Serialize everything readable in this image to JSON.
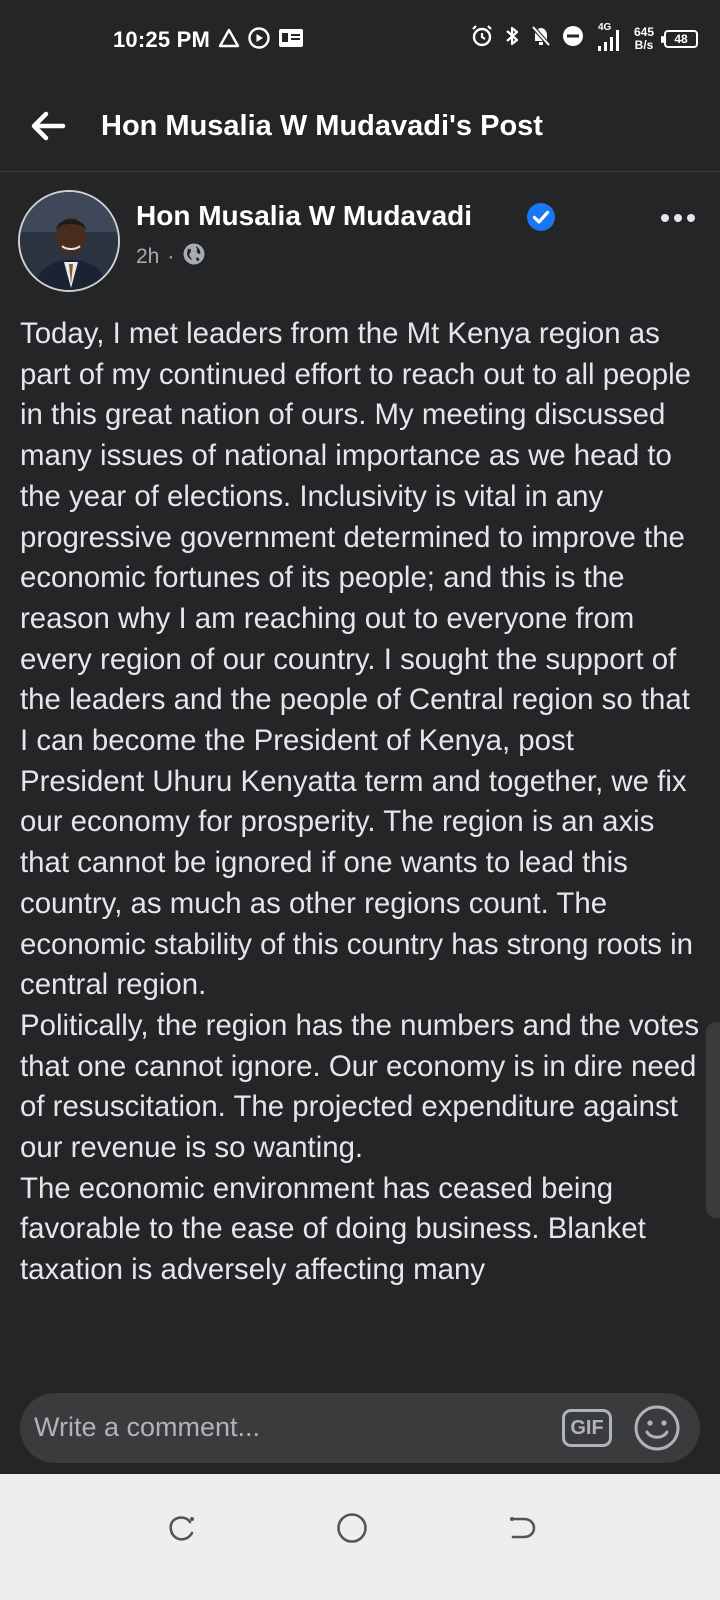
{
  "status_bar": {
    "time": "10:25 PM",
    "network_type": "4G",
    "net_speed_value": "645",
    "net_speed_unit": "B/s",
    "battery": "48",
    "icons": [
      "warning-icon",
      "record-icon",
      "mail-icon",
      "alarm-icon",
      "bluetooth-icon",
      "mute-icon",
      "dnd-icon",
      "signal-icon"
    ]
  },
  "header": {
    "title": "Hon Musalia W Mudavadi's Post",
    "back_icon": "arrow-left-icon"
  },
  "post": {
    "author": "Hon Musalia W Mudavadi",
    "verified": true,
    "time": "2h",
    "separator": "·",
    "audience_icon": "globe-icon",
    "body": "Today, I met leaders from the Mt Kenya region as part of my continued effort to reach out to all people in this great nation of ours. My meeting discussed many issues of national importance as we head to the year of elections. Inclusivity is vital in any progressive government determined to improve the economic fortunes of its people; and this is the reason why I am reaching out to everyone from every region of our country. I sought the support of the leaders and the people of Central region so that I can become the President of Kenya, post President Uhuru Kenyatta term and together, we fix our economy for prosperity. The region is an axis that cannot be ignored if one wants to lead this country, as much as other regions count. The economic stability of this country has strong roots in central region.\nPolitically, the region has the numbers and the votes that one cannot ignore. Our economy is in dire need of resuscitation. The projected expenditure against our revenue is so wanting.\nThe economic environment has ceased being favorable to the ease of doing business. Blanket taxation is adversely affecting many"
  },
  "comment": {
    "placeholder": "Write a comment...",
    "gif_label": "GIF",
    "emoji_icon": "smiley-icon"
  },
  "nav": {
    "icons": [
      "recents-icon",
      "home-icon",
      "back-icon"
    ]
  },
  "colors": {
    "background": "#242526",
    "text": "#e4e6eb",
    "muted": "#b0b3b8",
    "verified_blue": "#1877f2",
    "input_bg": "#3a3b3c",
    "navbar_bg": "#eeeeee"
  }
}
